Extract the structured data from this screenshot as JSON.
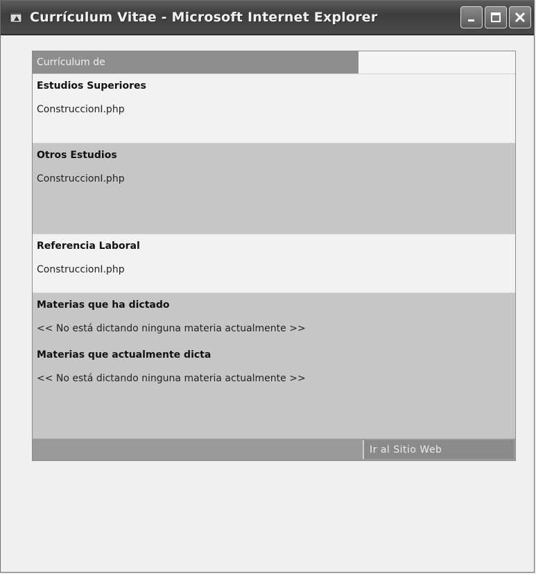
{
  "window": {
    "title": "Currículum Vitae - Microsoft Internet Explorer"
  },
  "cv": {
    "header": "Currículum de",
    "sections": [
      {
        "title": "Estudios Superiores",
        "body": "ConstruccionI.php"
      },
      {
        "title": "Otros Estudios",
        "body": "ConstruccionI.php"
      },
      {
        "title": "Referencia Laboral",
        "body": "ConstruccionI.php"
      }
    ],
    "materias": {
      "dictado_title": "Materias que ha dictado",
      "dictado_body": "<< No está dictando ninguna materia actualmente >>",
      "actual_title": "Materias que actualmente dicta",
      "actual_body": "<< No está dictando ninguna materia actualmente >>"
    },
    "footer": {
      "site_link": "Ir al Sitio Web"
    }
  },
  "colors": {
    "header_bg": "#8e8e8e",
    "light_section": "#f2f2f2",
    "dark_section": "#c6c6c6",
    "footer_bg": "#9a9a9a"
  },
  "icons": [
    "ie-window-icon",
    "minimize-icon",
    "maximize-icon",
    "close-icon"
  ]
}
